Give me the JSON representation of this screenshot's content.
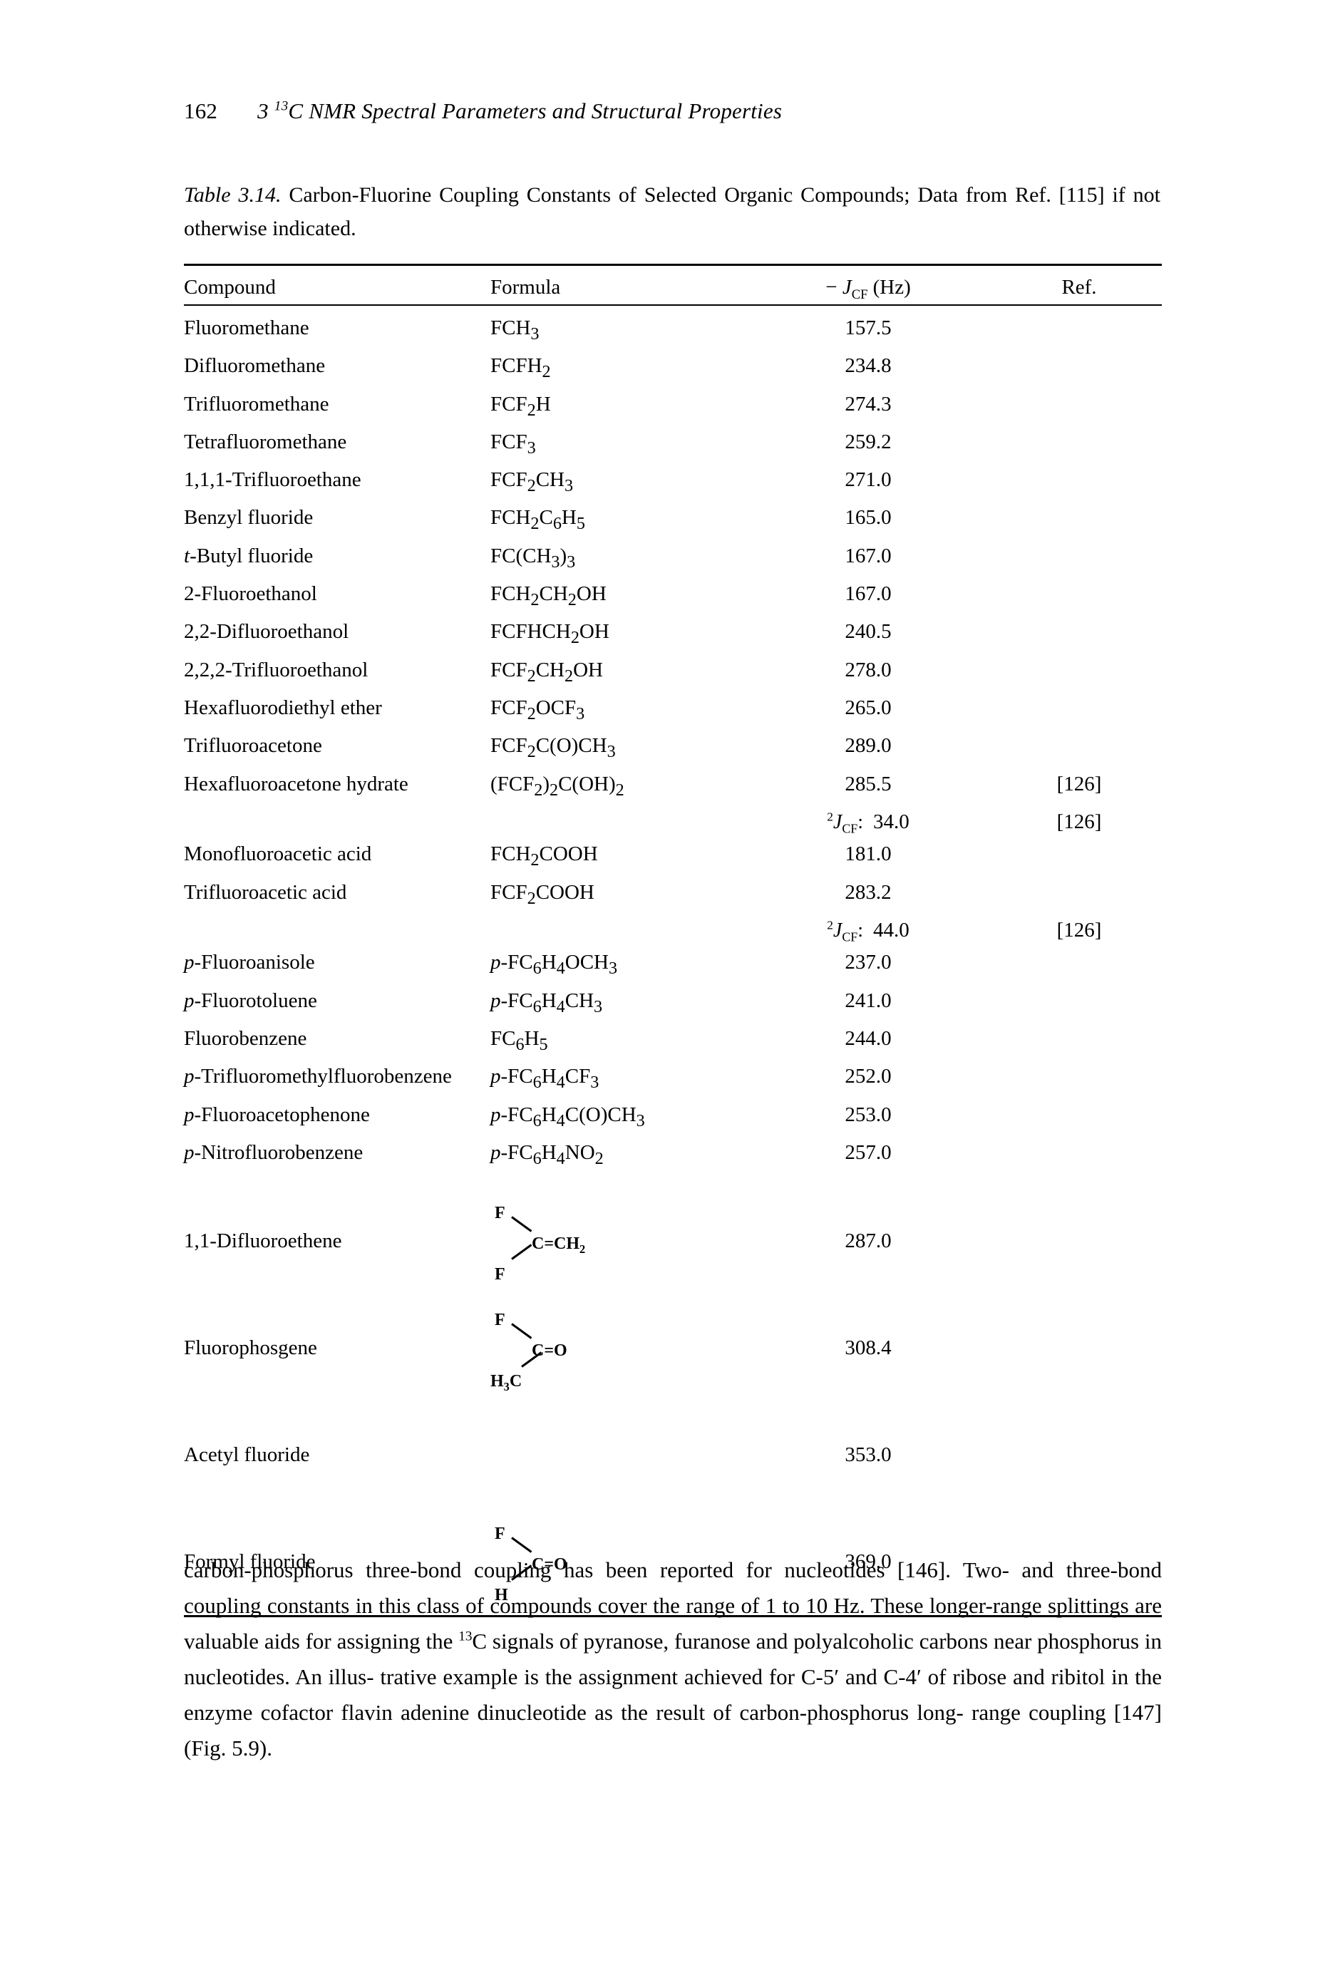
{
  "running_head": {
    "folio": "162",
    "chapter": "3",
    "isotope_sup": "13",
    "title_rest": "C NMR Spectral Parameters and Structural Properties"
  },
  "caption": {
    "label": "Table 3.14.",
    "text": "Carbon-Fluorine Coupling Constants of Selected Organic Compounds; Data from Ref. [115] if not otherwise indicated."
  },
  "table": {
    "headers": {
      "compound": "Compound",
      "formula": "Formula",
      "value_minus": "−",
      "value_j": "J",
      "value_j_sub": "CF",
      "value_units": "(Hz)",
      "ref": "Ref."
    },
    "sub_label": {
      "sup": "2",
      "j": "J",
      "sub": "CF",
      "colon": ":"
    },
    "rows": [
      {
        "compound": "Fluoromethane",
        "formula_html": "FCH<sub>3</sub>",
        "value": "157.5",
        "ref": ""
      },
      {
        "compound": "Difluoromethane",
        "formula_html": "FCFH<sub>2</sub>",
        "value": "234.8",
        "ref": ""
      },
      {
        "compound": "Trifluoromethane",
        "formula_html": "FCF<sub>2</sub>H",
        "value": "274.3",
        "ref": ""
      },
      {
        "compound": "Tetrafluoromethane",
        "formula_html": "FCF<sub>3</sub>",
        "value": "259.2",
        "ref": ""
      },
      {
        "compound": "1,1,1-Trifluoroethane",
        "formula_html": "FCF<sub>2</sub>CH<sub>3</sub>",
        "value": "271.0",
        "ref": ""
      },
      {
        "compound": "Benzyl fluoride",
        "formula_html": "FCH<sub>2</sub>C<sub>6</sub>H<sub>5</sub>",
        "value": "165.0",
        "ref": ""
      },
      {
        "compound_html": "<i>t</i>-Butyl fluoride",
        "compound": "t-Butyl fluoride",
        "formula_html": "FC(CH<sub>3</sub>)<sub>3</sub>",
        "value": "167.0",
        "ref": ""
      },
      {
        "compound": "2-Fluoroethanol",
        "formula_html": "FCH<sub>2</sub>CH<sub>2</sub>OH",
        "value": "167.0",
        "ref": ""
      },
      {
        "compound": "2,2-Difluoroethanol",
        "formula_html": "FCFHCH<sub>2</sub>OH",
        "value": "240.5",
        "ref": ""
      },
      {
        "compound": "2,2,2-Trifluoroethanol",
        "formula_html": "FCF<sub>2</sub>CH<sub>2</sub>OH",
        "value": "278.0",
        "ref": ""
      },
      {
        "compound": "Hexafluorodiethyl ether",
        "formula_html": "FCF<sub>2</sub>OCF<sub>3</sub>",
        "value": "265.0",
        "ref": ""
      },
      {
        "compound": "Trifluoroacetone",
        "formula_html": "FCF<sub>2</sub>C(O)CH<sub>3</sub>",
        "value": "289.0",
        "ref": ""
      },
      {
        "compound": "Hexafluoroacetone hydrate",
        "formula_html": "(FCF<sub>2</sub>)<sub>2</sub>C(OH)<sub>2</sub>",
        "value": "285.5",
        "ref": "[126]"
      },
      {
        "sub_row": true,
        "formula_html": "",
        "value": "34.0",
        "ref": "[126]"
      },
      {
        "compound": "Monofluoroacetic acid",
        "formula_html": "FCH<sub>2</sub>COOH",
        "value": "181.0",
        "ref": ""
      },
      {
        "compound": "Trifluoroacetic acid",
        "formula_html": "FCF<sub>2</sub>COOH",
        "value": "283.2",
        "ref": ""
      },
      {
        "sub_row": true,
        "formula_html": "",
        "value": "44.0",
        "ref": "[126]"
      },
      {
        "compound_html": "<i>p</i>-Fluoroanisole",
        "compound": "p-Fluoroanisole",
        "formula_html": "<i>p</i>-FC<sub>6</sub>H<sub>4</sub>OCH<sub>3</sub>",
        "value": "237.0",
        "ref": ""
      },
      {
        "compound_html": "<i>p</i>-Fluorotoluene",
        "compound": "p-Fluorotoluene",
        "formula_html": "<i>p</i>-FC<sub>6</sub>H<sub>4</sub>CH<sub>3</sub>",
        "value": "241.0",
        "ref": ""
      },
      {
        "compound": "Fluorobenzene",
        "formula_html": "FC<sub>6</sub>H<sub>5</sub>",
        "value": "244.0",
        "ref": ""
      },
      {
        "compound_html": "<i>p</i>-Trifluoromethylfluorobenzene",
        "compound": "p-Trifluoromethylfluorobenzene",
        "formula_html": "<i>p</i>-FC<sub>6</sub>H<sub>4</sub>CF<sub>3</sub>",
        "value": "252.0",
        "ref": ""
      },
      {
        "compound_html": "<i>p</i>-Fluoroacetophenone",
        "compound": "p-Fluoroacetophenone",
        "formula_html": "<i>p</i>-FC<sub>6</sub>H<sub>4</sub>C(O)CH<sub>3</sub>",
        "value": "253.0",
        "ref": ""
      },
      {
        "compound_html": "<i>p</i>-Nitrofluorobenzene",
        "compound": "p-Nitrofluorobenzene",
        "formula_html": "<i>p</i>-FC<sub>6</sub>H<sub>4</sub>NO<sub>2</sub>",
        "value": "257.0",
        "ref": ""
      }
    ],
    "structure_rows": [
      {
        "compound": "1,1-Difluoroethene",
        "value": "287.0",
        "ref": "",
        "structure": {
          "name": "difluoroethene-structure",
          "top_left": "F",
          "bottom_left": "F",
          "center": "C=CH",
          "center_sub": "2"
        }
      },
      {
        "compound": "Fluorophosgene",
        "value": "308.4",
        "ref": "",
        "structure": {
          "name": "fluorophosgene-structure",
          "top_left": "F",
          "bottom_left": "H",
          "bottom_left_sub": "3",
          "bottom_left_tail": "C",
          "center": "C=O"
        }
      },
      {
        "compound": "Acetyl fluoride",
        "value": "353.0",
        "ref": "",
        "structure": null
      },
      {
        "compound": "Formyl fluoride",
        "value": "369.0",
        "ref": "",
        "structure": {
          "name": "formyl-fluoride-structure",
          "top_left": "F",
          "bottom_left": "H",
          "center": "C=O"
        }
      }
    ]
  },
  "paragraph": {
    "line1": "carbon-phosphorus three-bond coupling has been reported for nucleotides [146]. Two-",
    "line2": "and three-bond coupling constants in this class of compounds cover the range of 1 to",
    "line3a": "10 Hz. These longer-range splittings are valuable aids for assigning the ",
    "line3_sup": "13",
    "line3b": "C signals of",
    "line4": "pyranose, furanose and polyalcoholic carbons near phosphorus in nucleotides. An illus-",
    "line5": "trative example is the assignment achieved for C-5′ and C-4′ of ribose and ribitol in the",
    "line6": "enzyme cofactor flavin adenine dinucleotide as the result of carbon-phosphorus long-",
    "line7": "range coupling [147] (Fig. 5.9)."
  }
}
